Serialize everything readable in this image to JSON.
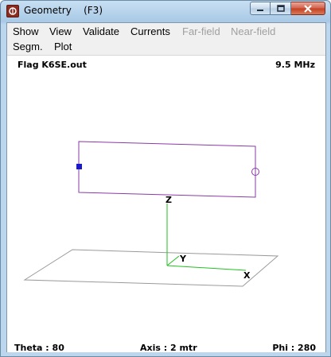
{
  "window": {
    "title": "Geometry    (F3)"
  },
  "menu": {
    "row1": [
      {
        "label": "Show",
        "enabled": true
      },
      {
        "label": "View",
        "enabled": true
      },
      {
        "label": "Validate",
        "enabled": true
      },
      {
        "label": "Currents",
        "enabled": true
      },
      {
        "label": "Far-field",
        "enabled": false
      },
      {
        "label": "Near-field",
        "enabled": false
      }
    ],
    "row2": [
      {
        "label": "Segm.",
        "enabled": true
      },
      {
        "label": "Plot",
        "enabled": true
      }
    ]
  },
  "canvas": {
    "filename": "Flag K6SE.out",
    "frequency": "9.5 MHz",
    "theta": "Theta : 80",
    "axis": "Axis : 2 mtr",
    "phi": "Phi : 280"
  },
  "axes": {
    "z_label": "Z",
    "y_label": "Y",
    "x_label": "X"
  },
  "icons": {
    "app": "app-icon",
    "minimize": "minimize-icon",
    "maximize": "maximize-icon",
    "close": "close-icon"
  },
  "colors": {
    "antenna": "#8a3aa8",
    "source": "#1a1acc",
    "axis": "#22c222",
    "ground": "#9a9a9a",
    "close_button": "#c33f22"
  }
}
